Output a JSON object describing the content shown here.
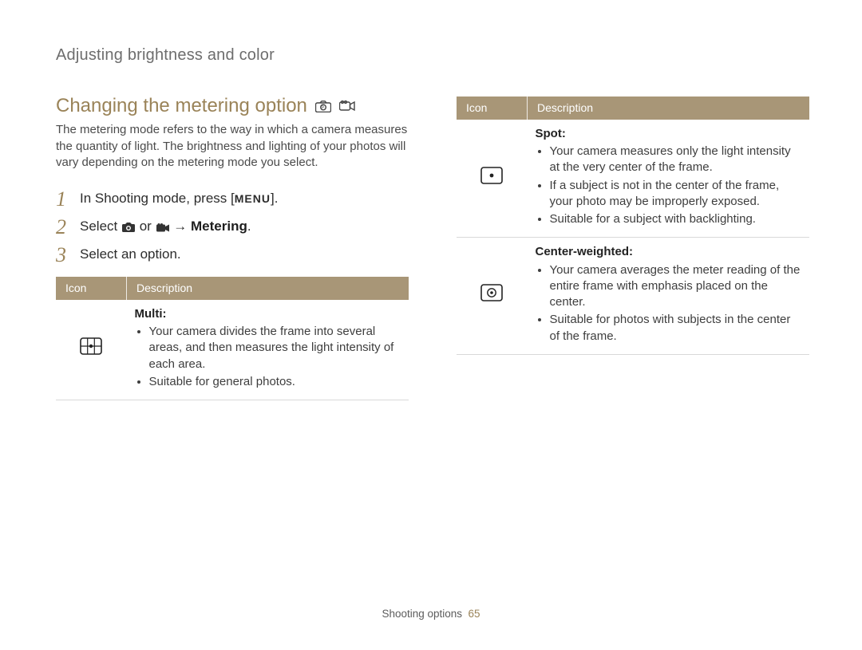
{
  "breadcrumb": "Adjusting brightness and color",
  "section_title": "Changing the metering option",
  "intro_text": "The metering mode refers to the way in which a camera measures the quantity of light. The brightness and lighting of your photos will vary depending on the metering mode you select.",
  "steps": {
    "s1_a": "In Shooting mode, press [",
    "s1_b": "].",
    "s1_menu": "MENU",
    "s2_a": "Select ",
    "s2_b": " or ",
    "s2_c": " → ",
    "s2_d": ".",
    "s2_bold": "Metering",
    "s3": "Select an option."
  },
  "table": {
    "header_icon": "Icon",
    "header_desc": "Description"
  },
  "options": {
    "multi": {
      "title": "Multi:",
      "b1": "Your camera divides the frame into several areas, and then measures the light intensity of each area.",
      "b2": "Suitable for general photos."
    },
    "spot": {
      "title": "Spot:",
      "b1": "Your camera measures only the light intensity at the very center of the frame.",
      "b2": "If a subject is not in the center of the frame, your photo may be improperly exposed.",
      "b3": "Suitable for a subject with backlighting."
    },
    "center": {
      "title": "Center-weighted:",
      "b1": "Your camera averages the meter reading of the entire frame with emphasis placed on the center.",
      "b2": "Suitable for photos with subjects in the center of the frame."
    }
  },
  "footer": {
    "section": "Shooting options",
    "page": "65"
  }
}
